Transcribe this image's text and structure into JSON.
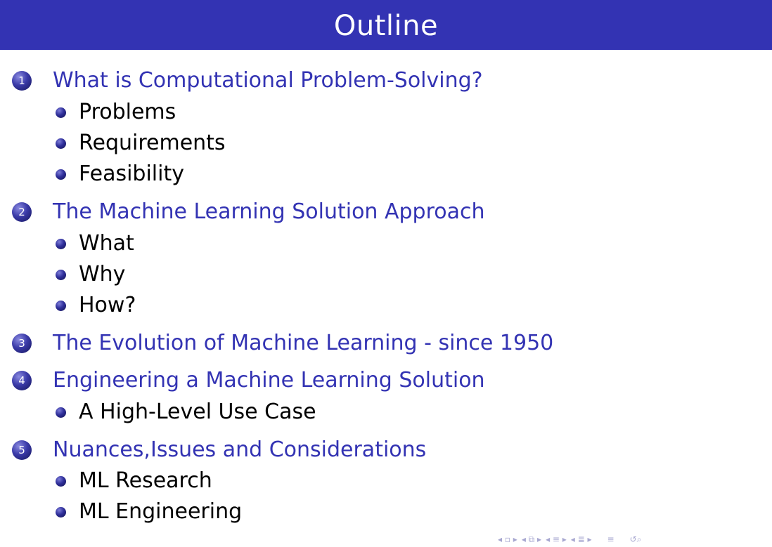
{
  "slide": {
    "title": "Outline"
  },
  "outline": {
    "sections": [
      {
        "number": "1",
        "title": "What is Computational Problem-Solving?",
        "items": [
          "Problems",
          "Requirements",
          "Feasibility"
        ]
      },
      {
        "number": "2",
        "title": "The Machine Learning Solution Approach",
        "items": [
          "What",
          "Why",
          "How?"
        ]
      },
      {
        "number": "3",
        "title": "The Evolution of Machine Learning - since 1950",
        "items": []
      },
      {
        "number": "4",
        "title": "Engineering a Machine Learning Solution",
        "items": [
          "A High-Level Use Case"
        ]
      },
      {
        "number": "5",
        "title": "Nuances,Issues and Considerations",
        "items": [
          "ML Research",
          "ML Engineering"
        ]
      }
    ]
  },
  "colors": {
    "title_bar": "#3333b3",
    "section_title": "#3333b3",
    "item_text": "#000000",
    "nav_icons": "#a7a7d0"
  },
  "nav": {
    "icons": [
      "nav-first-arrow-icon",
      "nav-frame-icon",
      "nav-next-arrow-icon",
      "nav-subsection-icon",
      "nav-section-icon",
      "nav-align-icon",
      "nav-search-icon"
    ]
  }
}
